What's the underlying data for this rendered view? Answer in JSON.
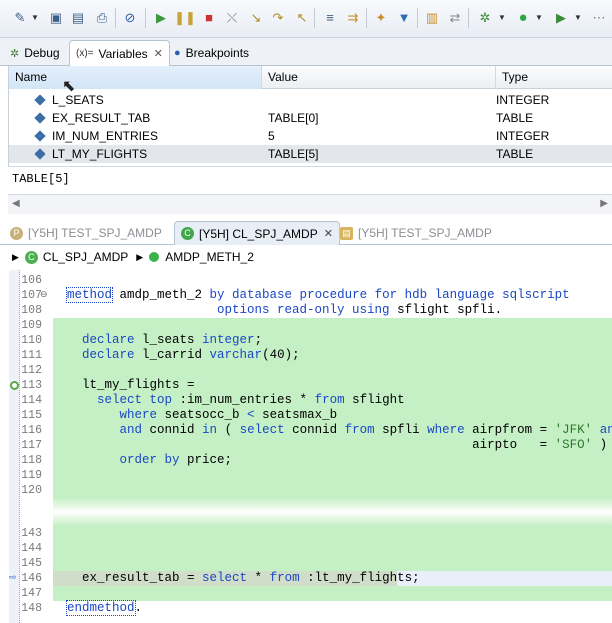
{
  "toolbar": {
    "icons": [
      "new-wizard-icon",
      "save-icon",
      "save-all-icon",
      "print-icon",
      "skip-breakpoints-icon",
      "resume-icon",
      "suspend-icon",
      "terminate-icon",
      "disconnect-icon",
      "step-into-icon",
      "step-over-icon",
      "step-return-icon",
      "drop-to-frame-icon",
      "use-step-filters-icon",
      "open-type-icon",
      "open-object-icon",
      "open-hierarchy-icon",
      "run-last-icon",
      "debug-icon",
      "run-icon",
      "external-tools-icon"
    ]
  },
  "views": {
    "tabs": [
      {
        "label": "Debug",
        "icon": "bug-icon"
      },
      {
        "label": "Variables",
        "prefix": "(x)=",
        "close": "✕"
      },
      {
        "label": "Breakpoints",
        "icon": "breakpoint-icon"
      }
    ]
  },
  "variables": {
    "columns": [
      "Name",
      "Value",
      "Type"
    ],
    "rows": [
      {
        "name": "L_SEATS",
        "value": "",
        "type": "INTEGER"
      },
      {
        "name": "EX_RESULT_TAB",
        "value": "TABLE[0]",
        "type": "TABLE"
      },
      {
        "name": "IM_NUM_ENTRIES",
        "value": "5",
        "type": "INTEGER"
      },
      {
        "name": "LT_MY_FLIGHTS",
        "value": "TABLE[5]",
        "type": "TABLE"
      }
    ],
    "detail": "TABLE[5]"
  },
  "editor": {
    "tabs": [
      {
        "label": "[Y5H] TEST_SPJ_AMDP",
        "icon": "program-icon"
      },
      {
        "label": "[Y5H] CL_SPJ_AMDP",
        "icon": "class-icon",
        "close": "✕"
      },
      {
        "label": "[Y5H] TEST_SPJ_AMDP",
        "icon": "debug-program-icon"
      }
    ],
    "breadcrumb": {
      "class": "CL_SPJ_AMDP",
      "method": "AMDP_METH_2"
    },
    "lines": [
      {
        "num": "106",
        "text": ""
      },
      {
        "num": "107",
        "text": "method amdp_meth_2 by database procedure for hdb language sqlscript"
      },
      {
        "num": "108",
        "text": "                    options read-only using sflight spfli."
      },
      {
        "num": "109",
        "text": ""
      },
      {
        "num": "110",
        "text": "  declare l_seats integer;"
      },
      {
        "num": "111",
        "text": "  declare l_carrid varchar(40);"
      },
      {
        "num": "112",
        "text": ""
      },
      {
        "num": "113",
        "text": "  lt_my_flights ="
      },
      {
        "num": "114",
        "text": "    select top :im_num_entries * from sflight"
      },
      {
        "num": "115",
        "text": "       where seatsocc_b < seatsmax_b"
      },
      {
        "num": "116",
        "text": "       and connid in ( select connid from spfli where airpfrom = 'JFK' and"
      },
      {
        "num": "117",
        "text": "                                                      airpto   = 'SFO' )"
      },
      {
        "num": "118",
        "text": "       order by price;"
      },
      {
        "num": "119",
        "text": ""
      },
      {
        "num": "120",
        "text": ""
      },
      {
        "num": "143",
        "text": ""
      },
      {
        "num": "144",
        "text": ""
      },
      {
        "num": "145",
        "text": ""
      },
      {
        "num": "146",
        "text": "  ex_result_tab = select * from :lt_my_flights;"
      },
      {
        "num": "147",
        "text": ""
      },
      {
        "num": "148",
        "text": "endmethod."
      }
    ]
  }
}
